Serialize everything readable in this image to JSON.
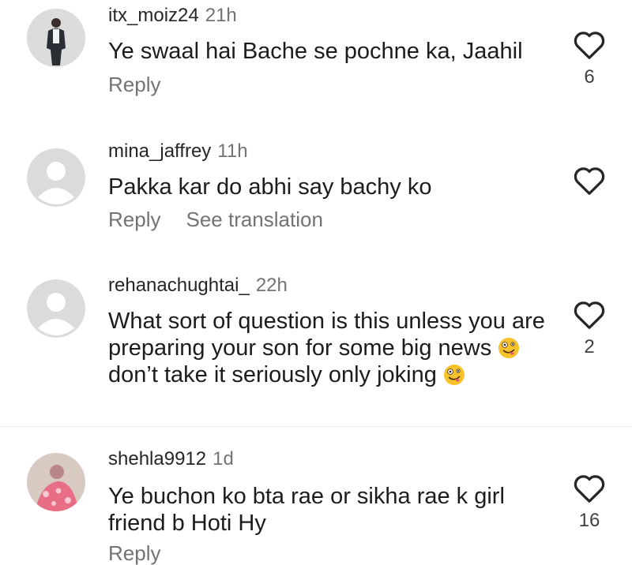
{
  "comments": [
    {
      "username": "itx_moiz24",
      "time": "21h",
      "text": "Ye swaal hai Bache se pochne ka, Jaahil",
      "reply_label": "Reply",
      "likes": "6",
      "avatar": "photo-person-standing"
    },
    {
      "username": "mina_jaffrey",
      "time": "11h",
      "text": "Pakka kar do abhi say bachy ko",
      "reply_label": "Reply",
      "translate_label": "See translation",
      "likes": "",
      "avatar": "default-avatar"
    },
    {
      "username": "rehanachughtai_",
      "time": "22h",
      "text_parts": [
        "What sort of question is this unless you are preparing your son for some big news",
        "don’t take it seriously only joking"
      ],
      "emoji": "zany-face-emoji",
      "likes": "2",
      "avatar": "default-avatar"
    },
    {
      "username": "shehla9912",
      "time": "1d",
      "text": "Ye buchon ko bta rae or sikha rae k girl friend b Hoti Hy",
      "reply_label": "Reply",
      "likes": "16",
      "avatar": "photo-pink-floral"
    }
  ],
  "colors": {
    "secondary_text": "#737373",
    "primary_text": "#1c1c1c",
    "heart_stroke": "#262626",
    "default_avatar_bg": "#dbdbdb",
    "default_avatar_fg": "#ffffff"
  }
}
